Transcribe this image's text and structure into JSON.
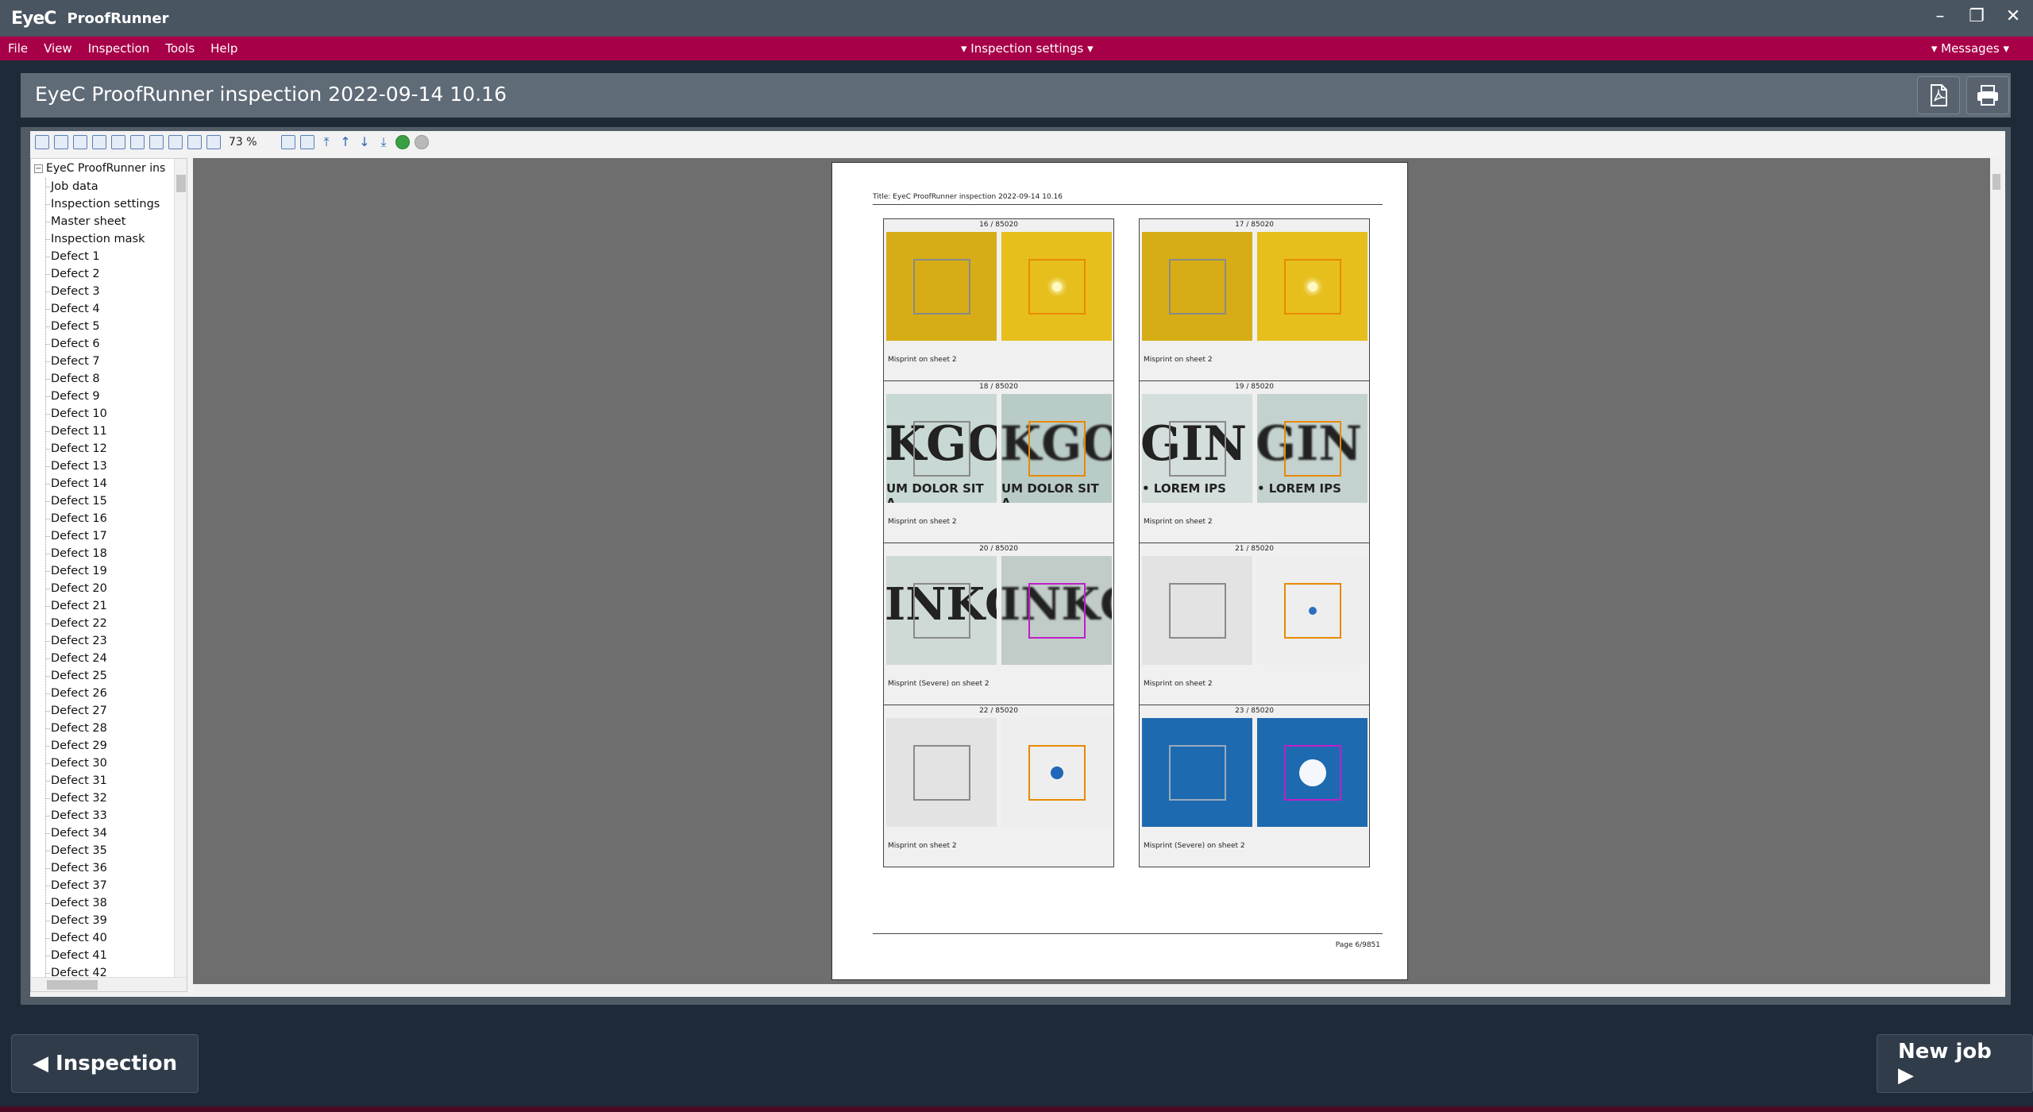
{
  "app": {
    "logo": "EyeC",
    "title": "ProofRunner"
  },
  "menu": {
    "items": [
      "File",
      "View",
      "Inspection",
      "Tools",
      "Help"
    ],
    "center": "▾ Inspection settings ▾",
    "right": "▾ Messages ▾"
  },
  "header": {
    "title": "EyeC ProofRunner inspection 2022-09-14 10.16"
  },
  "toolbar": {
    "zoom": "73 %"
  },
  "tree": {
    "root": "EyeC ProofRunner ins",
    "items": [
      "Job data",
      "Inspection settings",
      "Master sheet",
      "Inspection mask",
      "Defect 1",
      "Defect 2",
      "Defect 3",
      "Defect 4",
      "Defect 5",
      "Defect 6",
      "Defect 7",
      "Defect 8",
      "Defect 9",
      "Defect 10",
      "Defect 11",
      "Defect 12",
      "Defect 13",
      "Defect 14",
      "Defect 15",
      "Defect 16",
      "Defect 17",
      "Defect 18",
      "Defect 19",
      "Defect 20",
      "Defect 21",
      "Defect 22",
      "Defect 23",
      "Defect 24",
      "Defect 25",
      "Defect 26",
      "Defect 27",
      "Defect 28",
      "Defect 29",
      "Defect 30",
      "Defect 31",
      "Defect 32",
      "Defect 33",
      "Defect 34",
      "Defect 35",
      "Defect 36",
      "Defect 37",
      "Defect 38",
      "Defect 39",
      "Defect 40",
      "Defect 41",
      "Defect 42"
    ]
  },
  "page": {
    "title": "Title: EyeC ProofRunner inspection 2022-09-14 10.16",
    "footer": "Page 6/9851",
    "cards": [
      {
        "num": "16 / 85020",
        "caption": "Misprint on sheet 2"
      },
      {
        "num": "17 / 85020",
        "caption": "Misprint on sheet 2"
      },
      {
        "num": "18 / 85020",
        "caption": "Misprint on sheet 2",
        "text_l": "KGO",
        "text_r": "KGO",
        "sub_l": "UM DOLOR SIT A",
        "sub_r": "UM DOLOR SIT A"
      },
      {
        "num": "19 / 85020",
        "caption": "Misprint on sheet 2",
        "text_l": "GIN",
        "text_r": "GIN",
        "sub_l": "• LOREM IPS",
        "sub_r": "• LOREM IPS"
      },
      {
        "num": "20 / 85020",
        "caption": "Misprint (Severe) on sheet 2",
        "text_l": "INKG",
        "text_r": "INKG"
      },
      {
        "num": "21 / 85020",
        "caption": "Misprint on sheet 2"
      },
      {
        "num": "22 / 85020",
        "caption": "Misprint on sheet 2"
      },
      {
        "num": "23 / 85020",
        "caption": "Misprint (Severe) on sheet 2"
      }
    ]
  },
  "nav": {
    "back": "◀ Inspection",
    "next": "New job ▶"
  },
  "colors": {
    "menubar": "#a80048",
    "titlebar": "#4a5562",
    "orange_marker": "#e88a00",
    "magenta_marker": "#c01ec8",
    "yellow": "#d9b21a",
    "blue": "#1e6ab0"
  }
}
